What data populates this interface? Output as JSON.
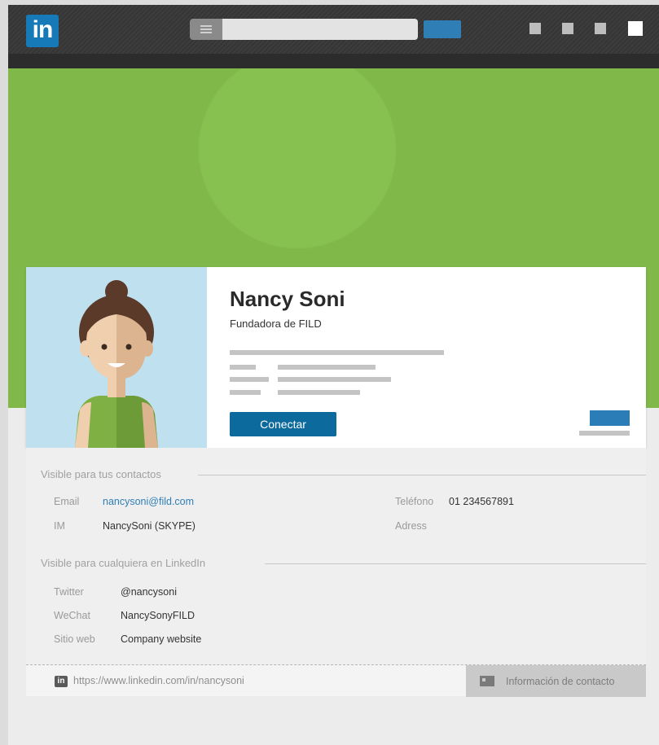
{
  "topbar": {
    "logo_text": "in",
    "search_placeholder": "",
    "brand_color": "#1679b8"
  },
  "profile": {
    "name": "Nancy Soni",
    "headline": "Fundadora de FILD",
    "connect_label": "Conectar",
    "banner_color": "#80b94a"
  },
  "contact": {
    "visible_contacts_title": "Visible para tus contactos",
    "email_label": "Email",
    "email_value": "nancysoni@fild.com",
    "im_label": "IM",
    "im_value": "NancySoni (SKYPE)",
    "phone_label": "Teléfono",
    "phone_value": "01 234567891",
    "address_label": "Adress",
    "public_title": "Visible para cualquiera en LinkedIn",
    "twitter_label": "Twitter",
    "twitter_value": "@nancysoni",
    "wechat_label": "WeChat",
    "wechat_value": "NancySonyFILD",
    "website_label": "Sitio web",
    "website_value": "Company website"
  },
  "footer": {
    "icon_text": "in",
    "profile_url": "https://www.linkedin.com/in/nancysoni",
    "contact_info_label": "Información de contacto"
  }
}
